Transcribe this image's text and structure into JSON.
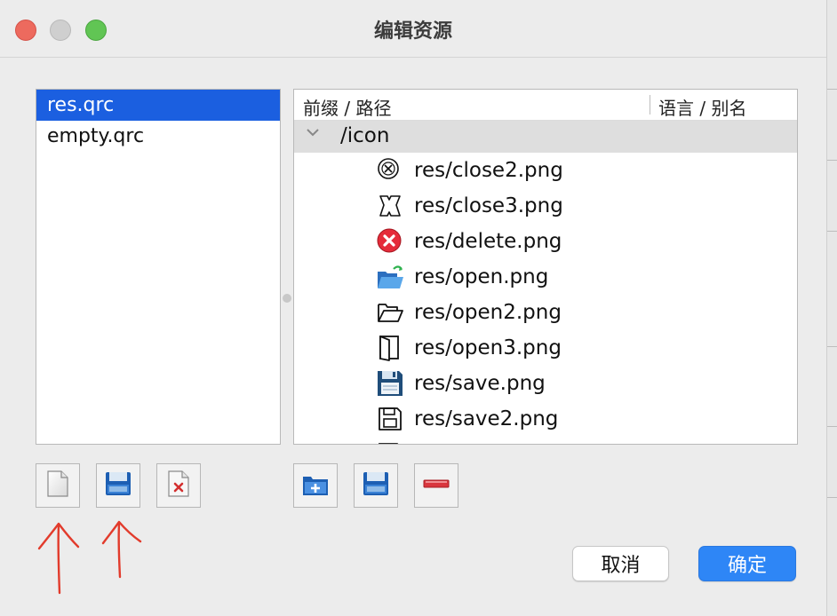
{
  "window": {
    "title": "编辑资源",
    "buttons": [
      "close",
      "minimize",
      "maximize"
    ]
  },
  "file_list": {
    "items": [
      {
        "label": "res.qrc",
        "selected": true
      },
      {
        "label": "empty.qrc",
        "selected": false
      }
    ]
  },
  "resource_tree": {
    "columns": {
      "col1": "前缀 / 路径",
      "col2": "语言 / 别名"
    },
    "prefix": {
      "label": "/icon",
      "expanded": true
    },
    "files": [
      {
        "label": "res/close2.png",
        "icon": "close-circle-outline-icon"
      },
      {
        "label": "res/close3.png",
        "icon": "close-badge-outline-icon"
      },
      {
        "label": "res/delete.png",
        "icon": "delete-red-circle-icon"
      },
      {
        "label": "res/open.png",
        "icon": "folder-open-blue-icon"
      },
      {
        "label": "res/open2.png",
        "icon": "folder-open-outline-icon"
      },
      {
        "label": "res/open3.png",
        "icon": "door-open-outline-icon"
      },
      {
        "label": "res/save.png",
        "icon": "floppy-disk-blue-icon"
      },
      {
        "label": "res/save2.png",
        "icon": "floppy-disk-outline-icon"
      }
    ]
  },
  "toolbar_left": [
    {
      "name": "new-file-button",
      "icon": "new-file-icon"
    },
    {
      "name": "save-file-button",
      "icon": "floppy-disk-icon"
    },
    {
      "name": "remove-file-button",
      "icon": "remove-file-icon"
    }
  ],
  "toolbar_right": [
    {
      "name": "add-prefix-button",
      "icon": "folder-add-icon"
    },
    {
      "name": "add-files-button",
      "icon": "floppy-disk-icon"
    },
    {
      "name": "remove-resource-button",
      "icon": "minus-icon"
    }
  ],
  "dialog_buttons": {
    "cancel": "取消",
    "ok": "确定"
  },
  "colors": {
    "selection": "#1b5fe0",
    "ok_button": "#2e86f6",
    "annotation_arrows": "#e23b2c"
  }
}
